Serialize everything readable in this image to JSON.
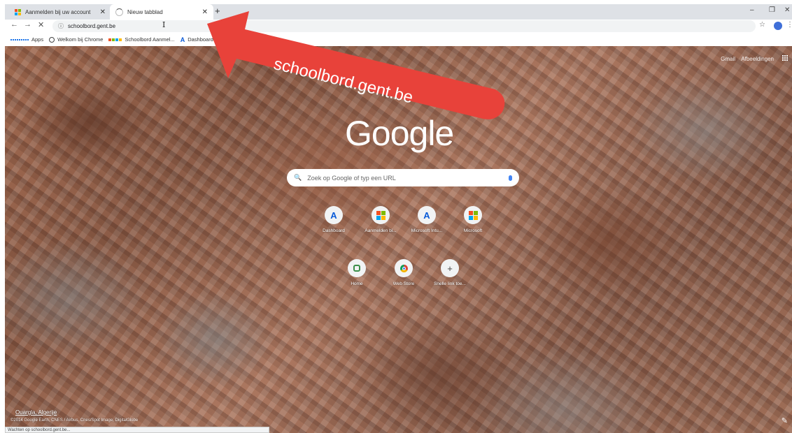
{
  "tabs": [
    {
      "title": "Aanmelden bij uw account",
      "active": false
    },
    {
      "title": "Nieuw tabblad",
      "active": true,
      "loading": true
    }
  ],
  "new_tab_symbol": "+",
  "window_controls": {
    "minimize": "–",
    "maximize": "❐",
    "close": "✕"
  },
  "toolbar": {
    "back_icon": "←",
    "forward_icon": "→",
    "stop_icon": "✕",
    "url": "schoolbord.gent.be",
    "info_icon": "ⓘ",
    "star_icon": "☆",
    "menu_icon": "⋮"
  },
  "bookmarks": [
    {
      "label": "Apps",
      "icon": "apps-grid"
    },
    {
      "label": "Welkom bij Chrome",
      "icon": "globe"
    },
    {
      "label": "Schoolbord Aanmel...",
      "icon": "microsoft"
    },
    {
      "label": "Dashboard - Intun",
      "icon": "azure"
    }
  ],
  "ntp": {
    "top_links": [
      "Gmail",
      "Afbeeldingen"
    ],
    "logo": "Google",
    "search_placeholder": "Zoek op Google of typ een URL",
    "search_icon": "🔍",
    "shortcuts_row1": [
      {
        "label": "Dashboard",
        "icon": "azure"
      },
      {
        "label": "Aanmelden bi...",
        "icon": "microsoft"
      },
      {
        "label": "Microsoft Intu...",
        "icon": "azure"
      },
      {
        "label": "Microsoft",
        "icon": "microsoft"
      }
    ],
    "shortcuts_row2": [
      {
        "label": "Home",
        "icon": "home"
      },
      {
        "label": "Web Store",
        "icon": "chrome-web-store"
      },
      {
        "label": "Snelle link toe...",
        "icon": "plus"
      }
    ],
    "location": "Ouargla, Algerije",
    "credit": "©2014 Google Earth, CNES / Airbus, Cnes/Spot Image, DigitalGlobe",
    "customize_icon": "✎"
  },
  "status_text": "Wachten op schoolbord.gent.be...",
  "annotation": {
    "text": "schoolbord.gent.be",
    "color": "#e8423a"
  },
  "colors": {
    "azure": "#0a5bd8",
    "ms_red": "#f25022",
    "ms_green": "#7fba00",
    "ms_blue": "#00a4ef",
    "ms_yellow": "#ffb900"
  }
}
